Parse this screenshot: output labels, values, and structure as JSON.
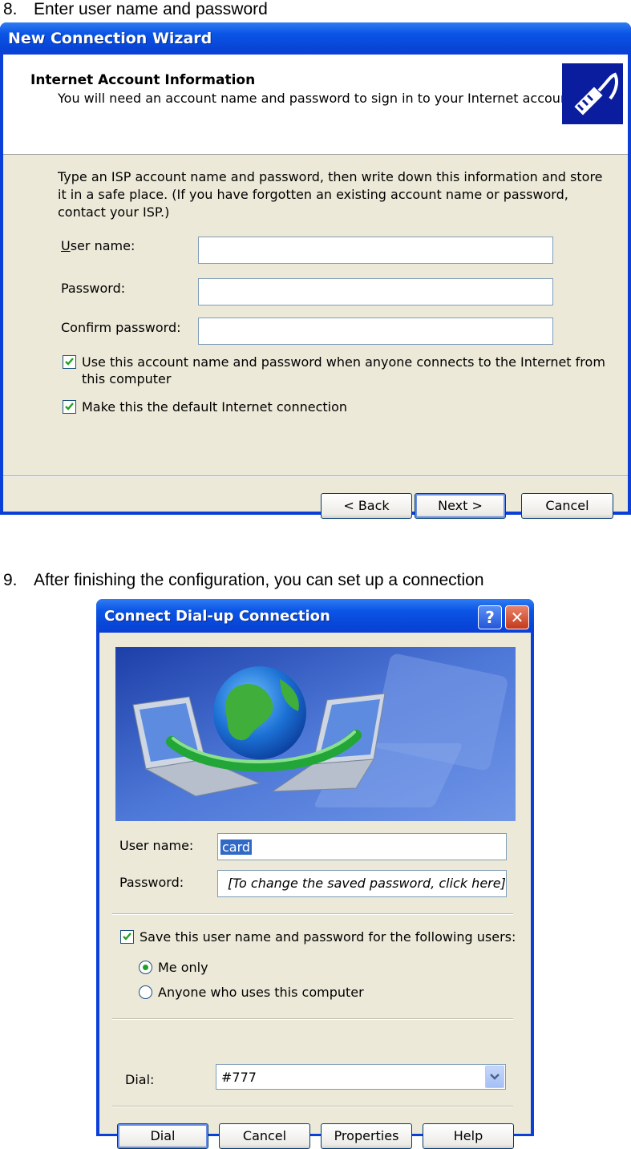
{
  "step8": {
    "number": "8.",
    "text": "Enter user name and password"
  },
  "wizard": {
    "title": "New Connection Wizard",
    "header_title": "Internet Account Information",
    "header_subtitle": "You will need an account name and password to sign in to your Internet account.",
    "header_icon": "network-cable-icon",
    "intro": "Type an ISP account name and password, then write down this information and store it in a safe place. (If you have forgotten an existing account name or password, contact your ISP.)",
    "username_label": "User name:",
    "password_label": "Password:",
    "confirm_label": "Confirm password:",
    "username_value": "",
    "password_value": "",
    "confirm_value": "",
    "use_account_label_1": "Use this account  name and password when anyone connects to the Internet from",
    "use_account_label_2": "this computer",
    "use_account_checked": true,
    "default_connection_label": "Make this the default Internet connection",
    "default_connection_checked": true,
    "back_label": "< Back",
    "next_label": "Next >",
    "cancel_label": "Cancel"
  },
  "step9": {
    "number": "9.",
    "text": "After finishing the configuration, you can set up a connection"
  },
  "dialup": {
    "title": "Connect Dial-up Connection",
    "help_glyph": "?",
    "close_glyph": "✕",
    "banner": "laptops-globe-icon",
    "username_label": "User name:",
    "username_value": "card",
    "password_label": "Password:",
    "password_value": "[To change the saved password, click here]",
    "save_label": "Save this user name and password for the following users:",
    "save_checked": true,
    "me_only_label": "Me only",
    "me_only_selected": true,
    "anyone_label": "Anyone who uses this computer",
    "dial_label": "Dial:",
    "dial_value": "#777",
    "dial_button": "Dial",
    "cancel_button": "Cancel",
    "properties_button": "Properties",
    "help_button": "Help"
  },
  "colors": {
    "titlebar": "#0a3fd8",
    "dialog_bg": "#ece9d8",
    "field_border": "#7f9db9",
    "button_border": "#003c74"
  }
}
